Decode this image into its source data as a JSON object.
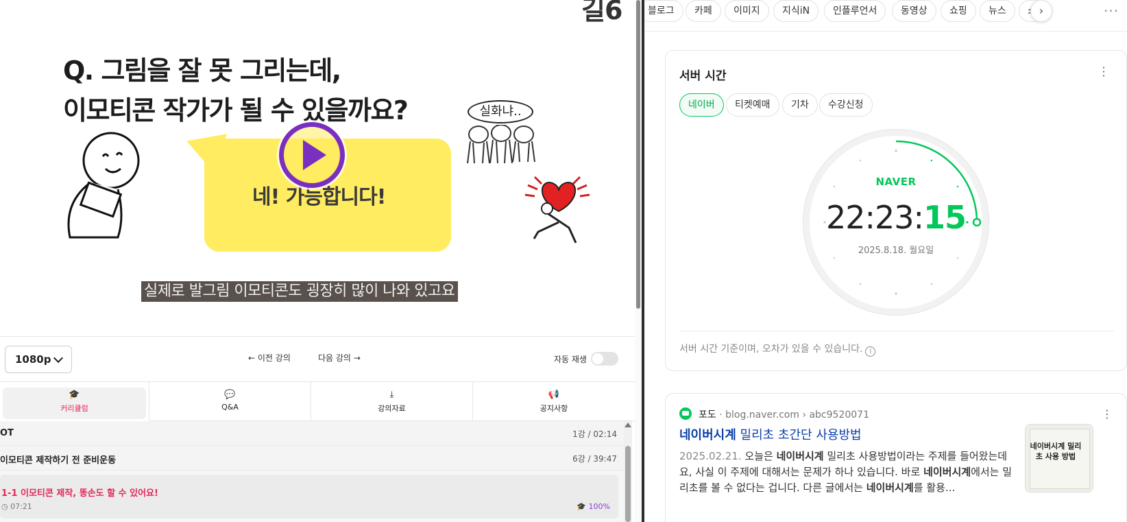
{
  "video": {
    "logo_partial": "길6",
    "question_line1": "Q. 그림을 잘 못 그리는데,",
    "question_line2": "이모티콘 작가가 될 수 있을까요?",
    "bubble_text": "네! 가능합니다!",
    "doodle_speech": "실화냐..",
    "subtitle": "실제로 발그림 이모티콘도 굉장히 많이 나와 있고요"
  },
  "controls": {
    "quality": "1080p",
    "prev": "이전 강의",
    "next": "다음 강의",
    "autoplay_label": "자동 재생",
    "autoplay_on": false
  },
  "tabs": [
    {
      "label": "커리큘럼",
      "icon": "graduation-cap-icon",
      "active": true
    },
    {
      "label": "Q&A",
      "icon": "chat-bubble-icon",
      "active": false
    },
    {
      "label": "강의자료",
      "icon": "download-icon",
      "active": false
    },
    {
      "label": "공지사항",
      "icon": "megaphone-icon",
      "active": false
    }
  ],
  "curriculum": {
    "sections": [
      {
        "title": "OT",
        "meta": "1강 / 02:14"
      },
      {
        "title": "이모티콘 제작하기 전 준비운동",
        "meta": "6강 / 39:47"
      }
    ],
    "current_lesson": {
      "title": "1-1 이모티콘 제작, 똥손도 할 수 있어요!",
      "duration": "07:21",
      "progress": "100%"
    }
  },
  "search_chips": [
    "블로그",
    "카페",
    "이미지",
    "지식iN",
    "인플루언서",
    "동영상",
    "쇼핑",
    "뉴스",
    "쇼"
  ],
  "server_time": {
    "title": "서버 시간",
    "tabs": [
      "네이버",
      "티켓예매",
      "기차",
      "수강신청"
    ],
    "active_tab": "네이버",
    "brand": "NAVER",
    "time_hm": "22:23:",
    "time_s": "15",
    "date": "2025.8.18. 월요일",
    "note": "서버 시간 기준이며, 오차가 있을 수 있습니다.",
    "seconds_fraction": 0.25
  },
  "result": {
    "source_name": "포도",
    "source_url": "· blog.naver.com › abc9520071",
    "title_bold": "네이버시계",
    "title_rest": " 밀리초 초간단 사용방법",
    "date": "2025.02.21.",
    "body_1": " 오늘은 ",
    "body_2": "네이버시계",
    "body_3": " 밀리초 사용방법이라는 주제를 들어왔는데요, 사실 이 주제에 대해서는 문제가 하나 있습니다. 바로 ",
    "body_4": "네이버시계",
    "body_5": "에서는 밀리초를 볼 수 없다는 겁니다. 다른 글에서는 ",
    "body_6": "네이버시계",
    "body_7": "를 활용...",
    "thumb_text": "네이버시계 밀리초 사용 방법"
  },
  "colors": {
    "naver_green": "#03c75a",
    "accent_pink": "#e2275a",
    "play_purple": "#7b2fc0",
    "bubble_yellow": "#ffec61",
    "link_blue": "#0a3ea8"
  }
}
